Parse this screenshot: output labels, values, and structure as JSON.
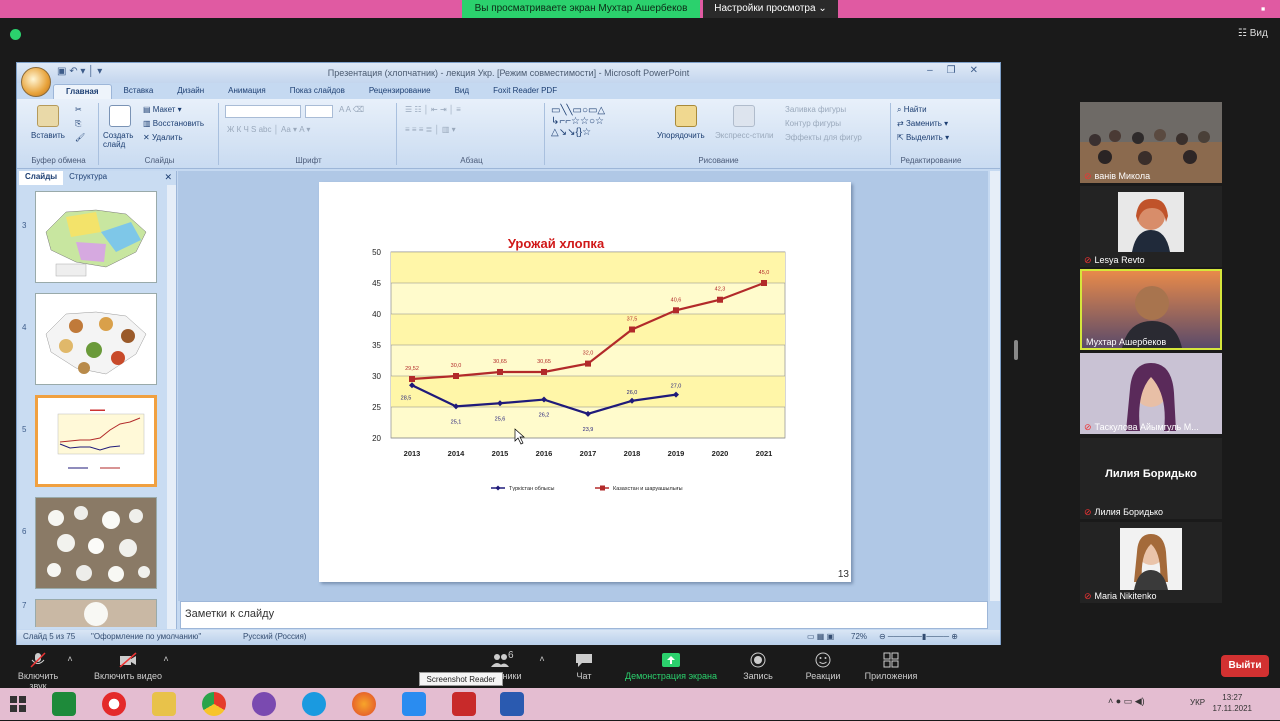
{
  "zoom": {
    "share_banner": "Вы просматриваете экран Мухтар Ашербеков",
    "view_settings": "Настройки просмотра",
    "view_button": "Вид",
    "toolbar": [
      {
        "label": "Включить звук"
      },
      {
        "label": "Включить видео"
      },
      {
        "label": "Участники",
        "count": "6"
      },
      {
        "label": "Чат"
      },
      {
        "label": "Демонстрация экрана"
      },
      {
        "label": "Запись"
      },
      {
        "label": "Реакции"
      },
      {
        "label": "Приложения"
      }
    ],
    "leave": "Выйти",
    "tooltip": "Screenshot Reader",
    "participants": [
      {
        "name": "ванів Микола"
      },
      {
        "name": "Lesya Revto"
      },
      {
        "name": "Мухтар Ашербеков"
      },
      {
        "name": "Таскулова Айымгуль М..."
      },
      {
        "name": "Лилия Боридько",
        "center": "Лилия Боридько"
      },
      {
        "name": "Maria Nikitenko"
      }
    ]
  },
  "ppt": {
    "title": "Презентация (хлопчатник) - лекция Укр. [Режим совместимости] - Microsoft PowerPoint",
    "tabs": [
      "Главная",
      "Вставка",
      "Дизайн",
      "Анимация",
      "Показ слайдов",
      "Рецензирование",
      "Вид",
      "Foxit Reader PDF"
    ],
    "ribbon": {
      "paste": "Вставить",
      "clipboard": "Буфер обмена",
      "new_slide": "Создать слайд",
      "layout": "Макет",
      "reset": "Восстановить",
      "delete": "Удалить",
      "slides": "Слайды",
      "font": "Шрифт",
      "paragraph": "Абзац",
      "arrange": "Упорядочить",
      "quick_styles": "Экспресс-стили",
      "shape_fill": "Заливка фигуры",
      "shape_outline": "Контур фигуры",
      "shape_effects": "Эффекты для фигур",
      "drawing": "Рисование",
      "find": "Найти",
      "replace": "Заменить",
      "select": "Выделить",
      "editing": "Редактирование"
    },
    "panel_tabs": [
      "Слайды",
      "Структура"
    ],
    "thumb_numbers": [
      "3",
      "4",
      "5",
      "6",
      "7"
    ],
    "notes": "Заметки к слайду",
    "slide_number": "13",
    "status": {
      "slide": "Слайд 5 из 75",
      "theme": "\"Оформление по умолчанию\"",
      "lang": "Русский (Россия)",
      "zoom": "72%"
    }
  },
  "chart_data": {
    "type": "line",
    "title": "Урожай хлопка",
    "x": [
      "2013",
      "2014",
      "2015",
      "2016",
      "2017",
      "2018",
      "2019",
      "2020",
      "2021"
    ],
    "ylim": [
      20,
      50
    ],
    "yticks": [
      "20",
      "25",
      "30",
      "35",
      "40",
      "45",
      "50"
    ],
    "series": [
      {
        "name": "Түркістан облысы",
        "color": "#1f1a7a",
        "values": [
          28.5,
          25.1,
          25.6,
          26.2,
          23.9,
          26.0,
          27.0,
          null,
          null
        ],
        "labels": [
          "28,5",
          "25,1",
          "25,6",
          "26,2",
          "23,9",
          "26,0",
          "27,0",
          "",
          ""
        ]
      },
      {
        "name": "Казахстан и шаруашылығы",
        "color": "#b22a2a",
        "values": [
          29.52,
          30.0,
          30.65,
          30.65,
          32.0,
          37.5,
          40.6,
          42.3,
          45.0
        ],
        "labels": [
          "29,52",
          "30,0",
          "30,65",
          "30,65",
          "32,0",
          "37,5",
          "40,6",
          "42,3",
          "45,0"
        ]
      }
    ]
  },
  "taskbar": {
    "time": "13:27",
    "date": "17.11.2021",
    "lang": "УКР"
  }
}
